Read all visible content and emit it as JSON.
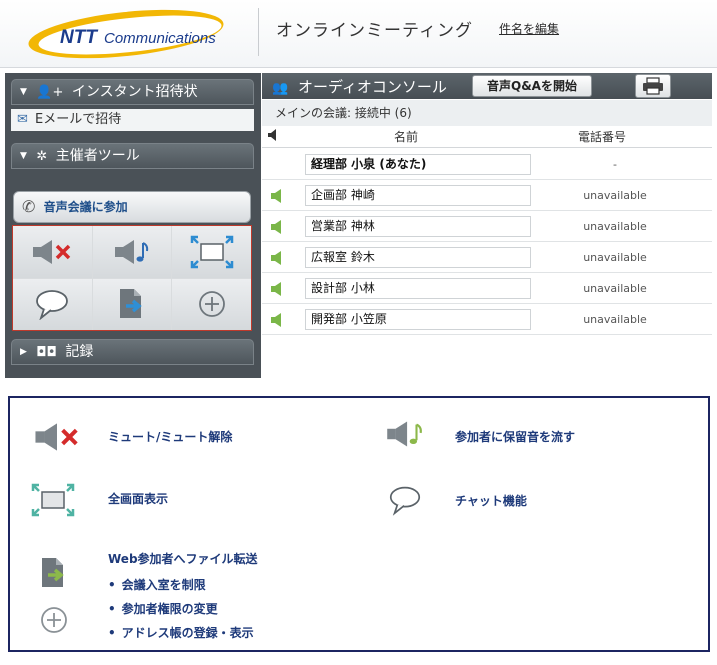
{
  "header": {
    "logo_text": "NTT Communications",
    "app_title": "オンラインミーティング",
    "edit_subject": "件名を編集"
  },
  "left_panel": {
    "instant_invite": "インスタント招待状",
    "email_invite": "Eメールで招待",
    "host_tools": "主催者ツール",
    "join_audio": "音声会議に参加",
    "record": "記録",
    "tools": [
      "mute-icon",
      "hold-music-icon",
      "fullscreen-icon",
      "chat-icon",
      "file-transfer-icon",
      "plus-icon"
    ]
  },
  "console": {
    "title": "オーディオコンソール",
    "qa_button": "音声Q&Aを開始",
    "status": "メインの会議: 接続中 (6)",
    "columns": {
      "name": "名前",
      "phone": "電話番号"
    },
    "participants": [
      {
        "name": "経理部  小泉 (あなた)",
        "phone": "-",
        "me": true,
        "speaker": false
      },
      {
        "name": "企画部  神崎",
        "phone": "unavailable",
        "me": false,
        "speaker": true
      },
      {
        "name": "営業部  神林",
        "phone": "unavailable",
        "me": false,
        "speaker": true
      },
      {
        "name": "広報室  鈴木",
        "phone": "unavailable",
        "me": false,
        "speaker": true
      },
      {
        "name": "設計部  小林",
        "phone": "unavailable",
        "me": false,
        "speaker": true
      },
      {
        "name": "開発部  小笠原",
        "phone": "unavailable",
        "me": false,
        "speaker": true
      }
    ]
  },
  "legend": {
    "mute": "ミュート/ミュート解除",
    "hold_music": "参加者に保留音を流す",
    "fullscreen": "全画面表示",
    "chat": "チャット機能",
    "file_transfer": "Web参加者へファイル転送",
    "sub_items": [
      "会議入室を制限",
      "参加者権限の変更",
      "アドレス帳の登録・表示"
    ]
  },
  "colors": {
    "accent_red": "#c0392b",
    "green": "#7ab648",
    "legend_text": "#1e3a7a",
    "teal": "#4fb3a3"
  }
}
